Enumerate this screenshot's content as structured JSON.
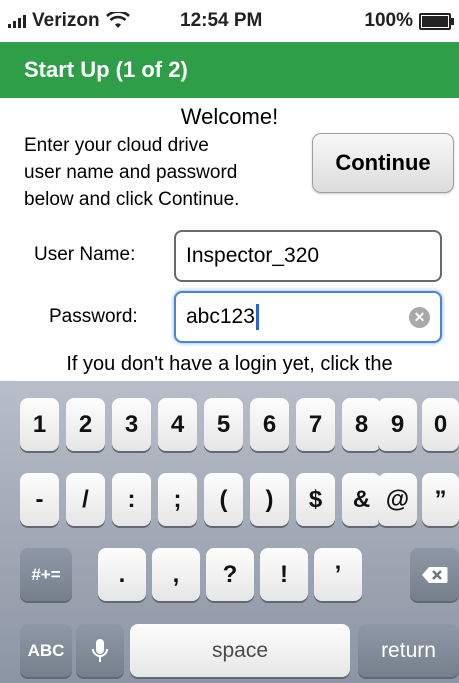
{
  "status_bar": {
    "carrier": "Verizon",
    "time": "12:54 PM",
    "battery": "100%",
    "icons": [
      "signal-bars-icon",
      "wifi-icon",
      "battery-icon"
    ]
  },
  "header": {
    "title": "Start Up (1 of 2)",
    "color": "#2f9e48"
  },
  "main": {
    "welcome": "Welcome!",
    "intro_lines": [
      "Enter your cloud drive",
      "user name and password",
      "below and click Continue."
    ],
    "continue_label": "Continue",
    "username_label": "User Name:",
    "username_value": "Inspector_320",
    "password_label": "Password:",
    "password_value": "abc123",
    "help_text": "If you don't have a login yet, click the"
  },
  "keyboard": {
    "row1": [
      "1",
      "2",
      "3",
      "4",
      "5",
      "6",
      "7",
      "8",
      "9",
      "0"
    ],
    "row2": [
      "-",
      "/",
      ":",
      ";",
      "(",
      ")",
      "$",
      "&",
      "@",
      "”"
    ],
    "row3": [
      ".",
      ",",
      "?",
      "!",
      "’"
    ],
    "symbols_key": "#+=",
    "abc_key": "ABC",
    "space_key": "space",
    "return_key": "return",
    "icons": [
      "microphone-icon",
      "backspace-icon"
    ]
  }
}
